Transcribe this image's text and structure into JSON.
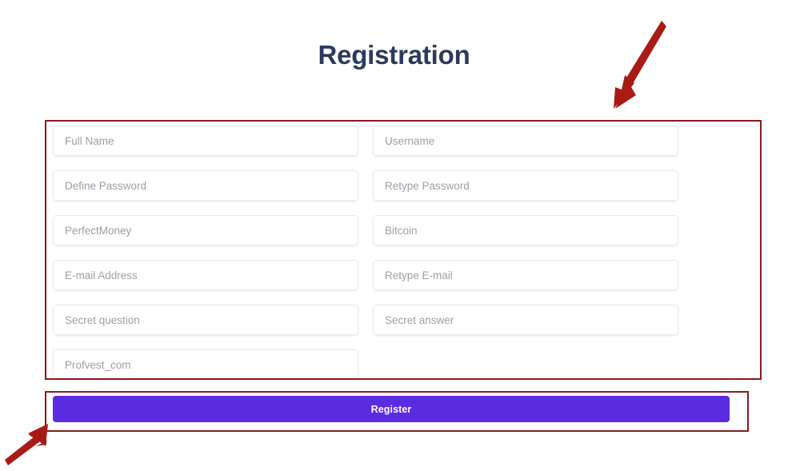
{
  "page": {
    "title": "Registration",
    "background_color": "#ffffff",
    "title_color": "#2b3a5c"
  },
  "form": {
    "rows": [
      {
        "left": {
          "name": "full-name",
          "placeholder": "Full Name",
          "value": ""
        },
        "right": {
          "name": "username",
          "placeholder": "Username",
          "value": ""
        }
      },
      {
        "left": {
          "name": "define-password",
          "placeholder": "Define Password",
          "value": ""
        },
        "right": {
          "name": "retype-password",
          "placeholder": "Retype Password",
          "value": ""
        }
      },
      {
        "left": {
          "name": "perfectmoney",
          "placeholder": "PerfectMoney",
          "value": ""
        },
        "right": {
          "name": "bitcoin",
          "placeholder": "Bitcoin",
          "value": ""
        }
      },
      {
        "left": {
          "name": "email-address",
          "placeholder": "E-mail Address",
          "value": ""
        },
        "right": {
          "name": "retype-email",
          "placeholder": "Retype E-mail",
          "value": ""
        }
      },
      {
        "left": {
          "name": "secret-question",
          "placeholder": "Secret question",
          "value": ""
        },
        "right": {
          "name": "secret-answer",
          "placeholder": "Secret answer",
          "value": ""
        }
      },
      {
        "left": {
          "name": "referrer",
          "placeholder": "Profvest_com",
          "value": ""
        },
        "right": null
      }
    ],
    "submit": {
      "label": "Register",
      "color": "#5a2be0",
      "text_color": "#ffffff"
    }
  },
  "annotations": {
    "color": "#8b1a1a",
    "boxes": [
      {
        "name": "fields-highlight",
        "target": "registration-fields"
      },
      {
        "name": "button-highlight",
        "target": "register-button"
      }
    ],
    "arrows": [
      {
        "name": "arrow-to-fields",
        "direction": "down-left"
      },
      {
        "name": "arrow-to-button",
        "direction": "up-right"
      }
    ]
  }
}
